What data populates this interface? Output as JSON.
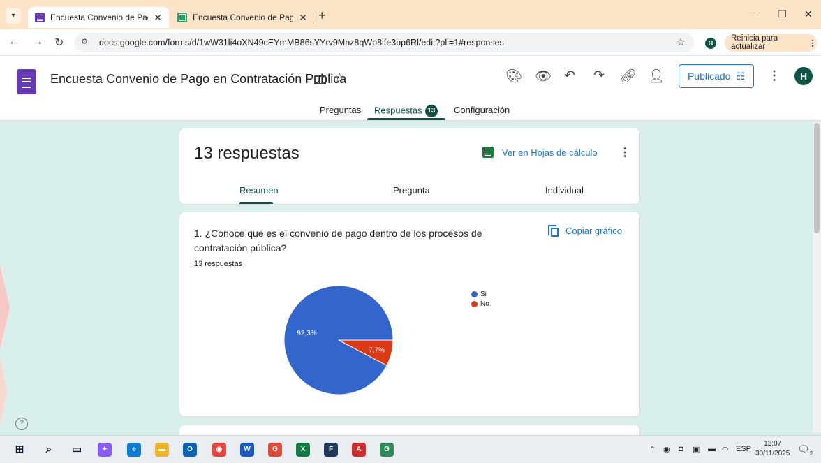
{
  "browser": {
    "tabs": [
      {
        "title": "Encuesta Convenio de Pago en",
        "close": "✕",
        "favicon": "forms-icon",
        "active": true
      },
      {
        "title": "Encuesta Convenio de Pago en",
        "close": "✕",
        "favicon": "sheets-icon",
        "active": false
      }
    ],
    "new_tab": "+",
    "url": "docs.google.com/forms/d/1wW31li4oXN49cEYmMB86sYYrv9Mnz8qWp8ife3bp6Rl/edit?pli=1#responses",
    "profile_initial": "H",
    "update_label": "Reinicia para actualizar"
  },
  "form": {
    "title": "Encuesta Convenio de Pago en Contratación Publica",
    "publish_label": "Publicado",
    "user_initial": "H",
    "tabs": {
      "questions": "Preguntas",
      "responses": "Respuestas",
      "responses_badge": "13",
      "settings": "Configuración"
    }
  },
  "summary": {
    "response_count": "13 respuestas",
    "sheets_link": "Ver en Hojas de cálculo",
    "subtabs": [
      "Resumen",
      "Pregunta",
      "Individual"
    ]
  },
  "question": {
    "text": "1.  ¿Conoce que es el convenio de pago dentro de los procesos de contratación pública?",
    "count": "13 respuestas",
    "copy_label": "Copiar gráfico"
  },
  "chart_data": {
    "type": "pie",
    "categories": [
      "Si",
      "No"
    ],
    "values": [
      92.3,
      7.7
    ],
    "labels": [
      "92,3%",
      "7,7%"
    ],
    "colors": [
      "#3366cc",
      "#dc3912"
    ],
    "legend_position": "right"
  },
  "taskbar": {
    "apps": [
      {
        "icon": "windows-start-icon",
        "color": "#0b1a2e"
      },
      {
        "icon": "search-icon",
        "color": "#0b1a2e"
      },
      {
        "icon": "task-view-icon",
        "color": "#0b1a2e"
      },
      {
        "icon": "copilot-icon",
        "color": "#8a5cf6"
      },
      {
        "icon": "edge-icon",
        "color": "#0c7bd3"
      },
      {
        "icon": "file-explorer-icon",
        "color": "#f0b428"
      },
      {
        "icon": "outlook-icon",
        "color": "#0a64b4"
      },
      {
        "icon": "chrome-icon",
        "color": "#e8453c"
      },
      {
        "icon": "word-icon",
        "color": "#185abd"
      },
      {
        "icon": "chrome-profile-icon",
        "color": "#dd4b39"
      },
      {
        "icon": "excel-icon",
        "color": "#107c41"
      },
      {
        "icon": "app-icon",
        "color": "#1e3a5f"
      },
      {
        "icon": "acrobat-icon",
        "color": "#d22d2d"
      },
      {
        "icon": "chrome-profile-h-icon",
        "color": "#2e8b57"
      }
    ],
    "language": "ESP",
    "time": "13:07",
    "date": "30/11/2025",
    "notification_count": "2"
  }
}
